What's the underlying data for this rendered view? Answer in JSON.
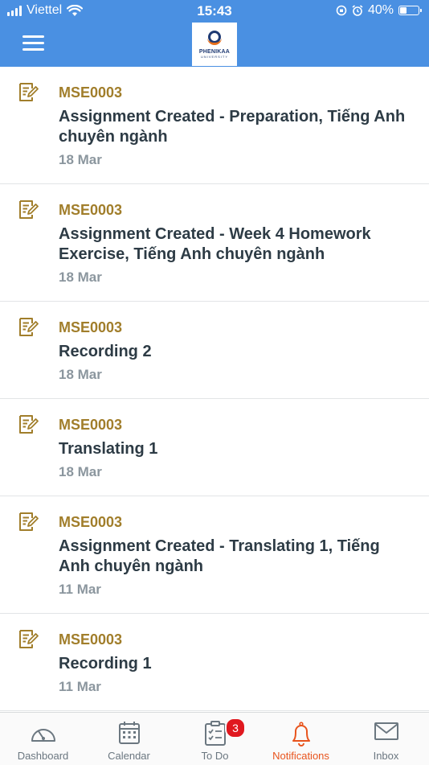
{
  "status_bar": {
    "carrier": "Viettel",
    "time": "15:43",
    "battery_percent": "40%",
    "battery_level": 0.4
  },
  "header": {
    "logo_name": "PHENIKAA",
    "logo_sub": "UNIVERSITY",
    "accent_color": "#4a90e2"
  },
  "notifications": [
    {
      "course": "MSE0003",
      "title": "Assignment Created - Preparation, Tiếng Anh chuyên ngành",
      "date": "18 Mar"
    },
    {
      "course": "MSE0003",
      "title": "Assignment Created - Week 4 Homework Exercise, Tiếng Anh chuyên ngành",
      "date": "18 Mar"
    },
    {
      "course": "MSE0003",
      "title": "Recording 2",
      "date": "18 Mar"
    },
    {
      "course": "MSE0003",
      "title": "Translating 1",
      "date": "18 Mar"
    },
    {
      "course": "MSE0003",
      "title": "Assignment Created - Translating 1, Tiếng Anh chuyên ngành",
      "date": "11 Mar"
    },
    {
      "course": "MSE0003",
      "title": "Recording 1",
      "date": "11 Mar"
    }
  ],
  "tabs": [
    {
      "label": "Dashboard",
      "icon": "dashboard-icon"
    },
    {
      "label": "Calendar",
      "icon": "calendar-icon"
    },
    {
      "label": "To Do",
      "icon": "todo-icon",
      "badge": "3"
    },
    {
      "label": "Notifications",
      "icon": "bell-icon",
      "active": true
    },
    {
      "label": "Inbox",
      "icon": "inbox-icon"
    }
  ]
}
